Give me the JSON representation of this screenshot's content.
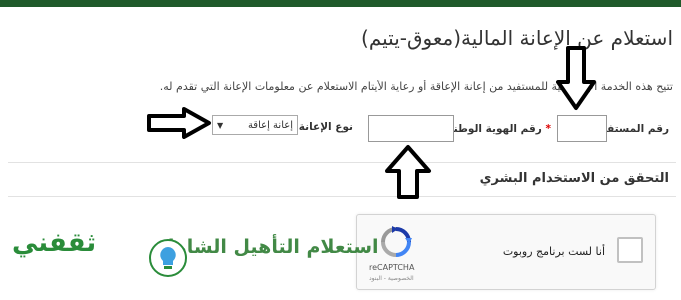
{
  "page": {
    "title": "استعلام عن الإعانة المالية(معوق-يتيم)",
    "intro": "تتيح هذه الخدمة الإلكترونية للمستفيد من إعانة الإعاقة أو رعاية الأيتام الاستعلام عن معلومات الإعانة التي تقدم له."
  },
  "form": {
    "beneficiary_label": "رقم المستفيد",
    "national_id_label": "رقم الهوية الوطنية",
    "required_mark": "*",
    "aid_type_label": "نوع الإعانة",
    "aid_type_selected": "إعانة إعاقة"
  },
  "verification": {
    "title": "التحقق من الاستخدام البشري"
  },
  "captcha": {
    "label": "أنا لست برنامج روبوت",
    "brand": "reCAPTCHA",
    "terms": "الخصوصية - البنود"
  },
  "watermark": {
    "text": "استعلام التأهيل الشامل",
    "logo_text": "ثقفني"
  },
  "colors": {
    "topbar": "#1f5a2a",
    "watermark_green": "#2e7d32"
  }
}
